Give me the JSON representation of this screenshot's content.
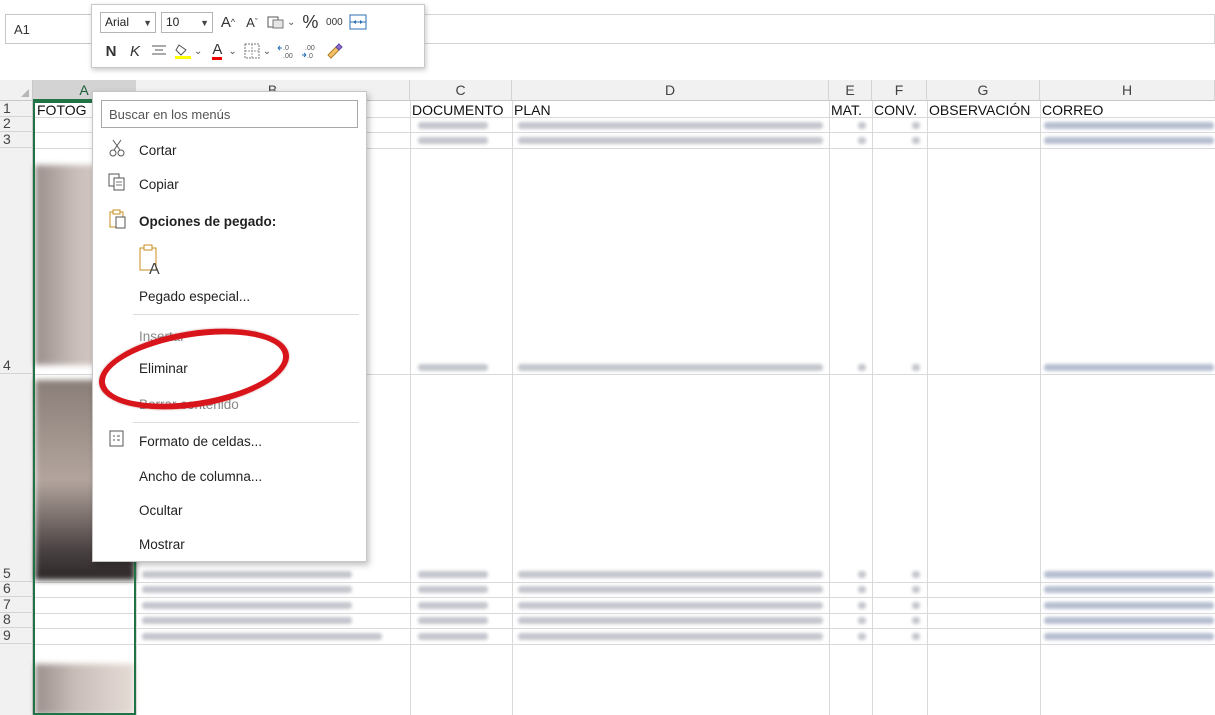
{
  "name_box": "A1",
  "mini_toolbar": {
    "font_name": "Arial",
    "font_size": "10",
    "increase_font": "A",
    "decrease_font": "A",
    "percent": "%",
    "thousands": "000",
    "bold": "N",
    "italic": "K",
    "font_color_letter": "A"
  },
  "columns": [
    "A",
    "B",
    "C",
    "D",
    "E",
    "F",
    "G",
    "H"
  ],
  "rows": [
    "1",
    "2",
    "3",
    "4",
    "5",
    "6",
    "7",
    "8",
    "9"
  ],
  "header_row": {
    "A": "FOTOG",
    "C": "DOCUMENTO",
    "D": "PLAN",
    "E": "MAT.",
    "F": "CONV.",
    "G": "OBSERVACIÓN",
    "H": "CORREO"
  },
  "context_menu": {
    "search_placeholder": "Buscar en los menús",
    "items": {
      "cut": "Cortar",
      "copy": "Copiar",
      "paste_options": "Opciones de pegado:",
      "paste_special": "Pegado especial...",
      "insert": "Insertar",
      "delete": "Eliminar",
      "clear_contents": "Borrar contenido",
      "format_cells": "Formato de celdas...",
      "column_width": "Ancho de columna...",
      "hide": "Ocultar",
      "show": "Mostrar"
    }
  },
  "colors": {
    "selection_green": "#217346",
    "highlight_red": "#d8151b",
    "header_bg": "#f1f1f1"
  }
}
